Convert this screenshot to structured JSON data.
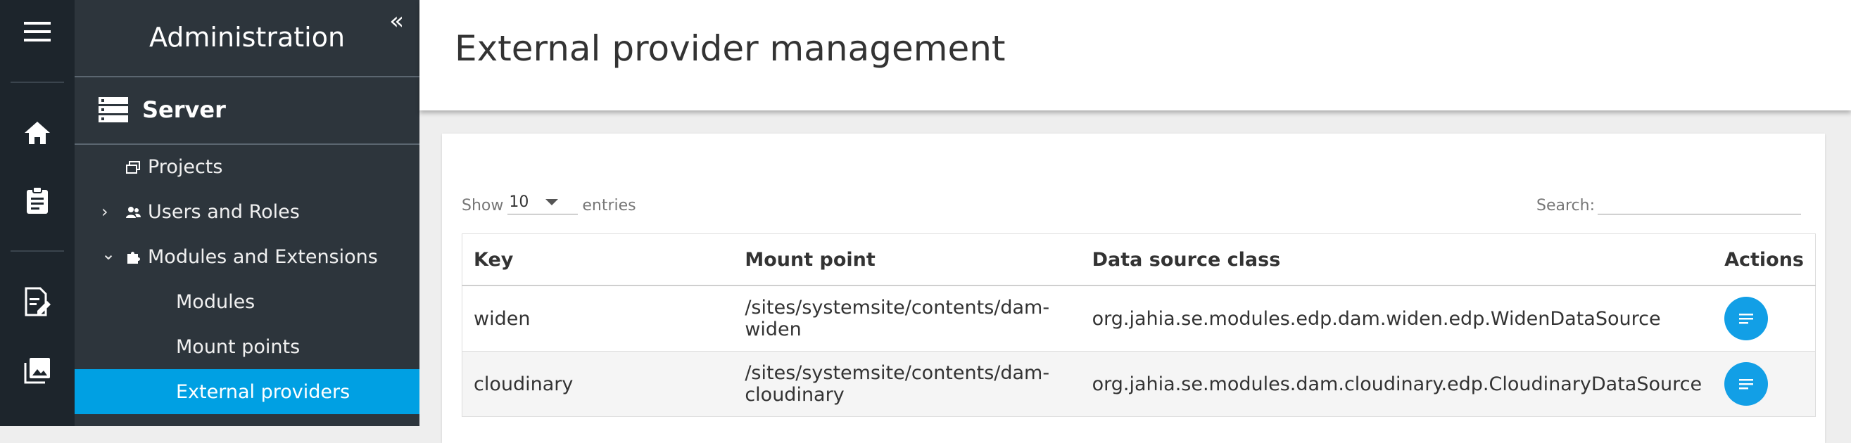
{
  "sidebar": {
    "title": "Administration",
    "collapse_glyph": "«",
    "section": "Server",
    "items": [
      {
        "label": "Projects",
        "icon": "projects-icon"
      },
      {
        "label": "Users and Roles",
        "icon": "users-icon",
        "chevron": "›"
      },
      {
        "label": "Modules and Extensions",
        "icon": "puzzle-icon",
        "chevron": "⌄"
      },
      {
        "label": "Modules"
      },
      {
        "label": "Mount points"
      },
      {
        "label": "External providers",
        "active": true
      }
    ]
  },
  "rail": [
    "menu-icon",
    "home-icon",
    "clipboard-icon",
    "page-edit-icon",
    "images-icon"
  ],
  "page": {
    "title": "External provider management"
  },
  "table_controls": {
    "show_label": "Show",
    "page_length": "10",
    "entries_label": "entries",
    "search_label": "Search:",
    "search_value": ""
  },
  "table": {
    "headers": [
      "Key",
      "Mount point",
      "Data source class",
      "Actions"
    ],
    "rows": [
      {
        "key": "widen",
        "mount": "/sites/systemsite/contents/dam-widen",
        "class": "org.jahia.se.modules.edp.dam.widen.edp.WidenDataSource"
      },
      {
        "key": "cloudinary",
        "mount": "/sites/systemsite/contents/dam-cloudinary",
        "class": "org.jahia.se.modules.dam.cloudinary.edp.CloudinaryDataSource"
      }
    ]
  },
  "colors": {
    "accent": "#00a0e3",
    "sidebar": "#2d353c",
    "rail": "#1d252c"
  }
}
